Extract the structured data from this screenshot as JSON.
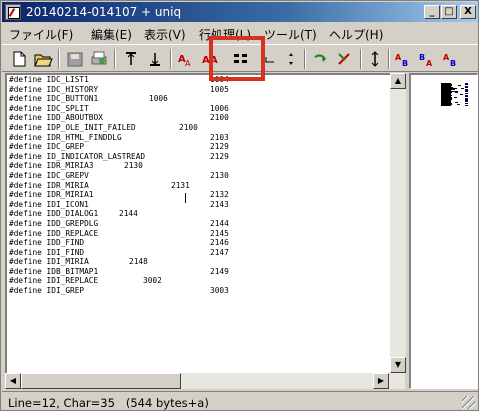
{
  "window": {
    "title": "20140214-014107 + uniq",
    "controls": {
      "minimize": "_",
      "maximize": "□",
      "close": "X"
    }
  },
  "menu": [
    "ファイル(F)",
    "編集(E)",
    "表示(V)",
    "行処理(L)",
    "ツール(T)",
    "ヘルプ(H)"
  ],
  "toolbar": [
    "new-file-icon",
    "open-file-icon",
    "save-icon",
    "print-icon",
    "print-preview-icon",
    "sort-ascending-icon",
    "sort-descending-icon",
    "text-case-icon",
    "text-format-icon",
    "split-columns-icon",
    "merge-lines-icon",
    "move-up-down-icon",
    "find-next-icon",
    "mark-icon",
    "swap-lines-icon",
    "compare-ab-icon",
    "compare-ba-icon",
    "compare-ab-alt-icon"
  ],
  "editor": {
    "lines": [
      {
        "text": "#define IDC_LIST1",
        "value": "1004",
        "col": "right"
      },
      {
        "text": "#define IDC_HISTORY",
        "value": "1005",
        "col": "right"
      },
      {
        "text": "#define IDC_BUTTON1",
        "value": "1006",
        "col": "mid"
      },
      {
        "text": "#define IDC_SPLIT",
        "value": "1006",
        "col": "right"
      },
      {
        "text": "#define IDD_ABOUTBOX",
        "value": "2100",
        "col": "right"
      },
      {
        "text": "#define IDP_OLE_INIT_FAILED",
        "value": "2100",
        "col": "mid2"
      },
      {
        "text": "#define IDR_HTML_FINDDLG",
        "value": "2103",
        "col": "right"
      },
      {
        "text": "#define IDC_GREP",
        "value": "2129",
        "col": "right"
      },
      {
        "text": "#define ID_INDICATOR_LASTREAD",
        "value": "2129",
        "col": "right"
      },
      {
        "text": "#define IDR_MIRIA3",
        "value": "2130",
        "col": "near"
      },
      {
        "text": "#define IDC_GREPV",
        "value": "2130",
        "col": "right"
      },
      {
        "text": "#define IDR_MIRIA",
        "value": "2131",
        "col": "mid3"
      },
      {
        "text": "#define IDR_MIRIA1",
        "value": "2132",
        "col": "right"
      },
      {
        "text": "#define IDI_ICON1",
        "value": "2143",
        "col": "right"
      },
      {
        "text": "#define IDD_DIALOG1",
        "value": "2144",
        "col": "near2"
      },
      {
        "text": "#define IDD_GREPDLG",
        "value": "2144",
        "col": "right"
      },
      {
        "text": "#define IDD_REPLACE",
        "value": "2145",
        "col": "right"
      },
      {
        "text": "#define IDD_FIND",
        "value": "2146",
        "col": "right"
      },
      {
        "text": "#define IDI_FIND",
        "value": "2147",
        "col": "right"
      },
      {
        "text": "#define IDI_MIRIA",
        "value": "2148",
        "col": "near3"
      },
      {
        "text": "#define IDB_BITMAP1",
        "value": "2149",
        "col": "right"
      },
      {
        "text": "#define IDI_REPLACE",
        "value": "3002",
        "col": "near4"
      },
      {
        "text": "#define IDI_GREP",
        "value": "3003",
        "col": "right"
      }
    ]
  },
  "status": "Line=12, Char=35   (544 bytes+a)",
  "colors": {
    "highlight": "#d7321e",
    "titlebar": "#0a246a"
  }
}
